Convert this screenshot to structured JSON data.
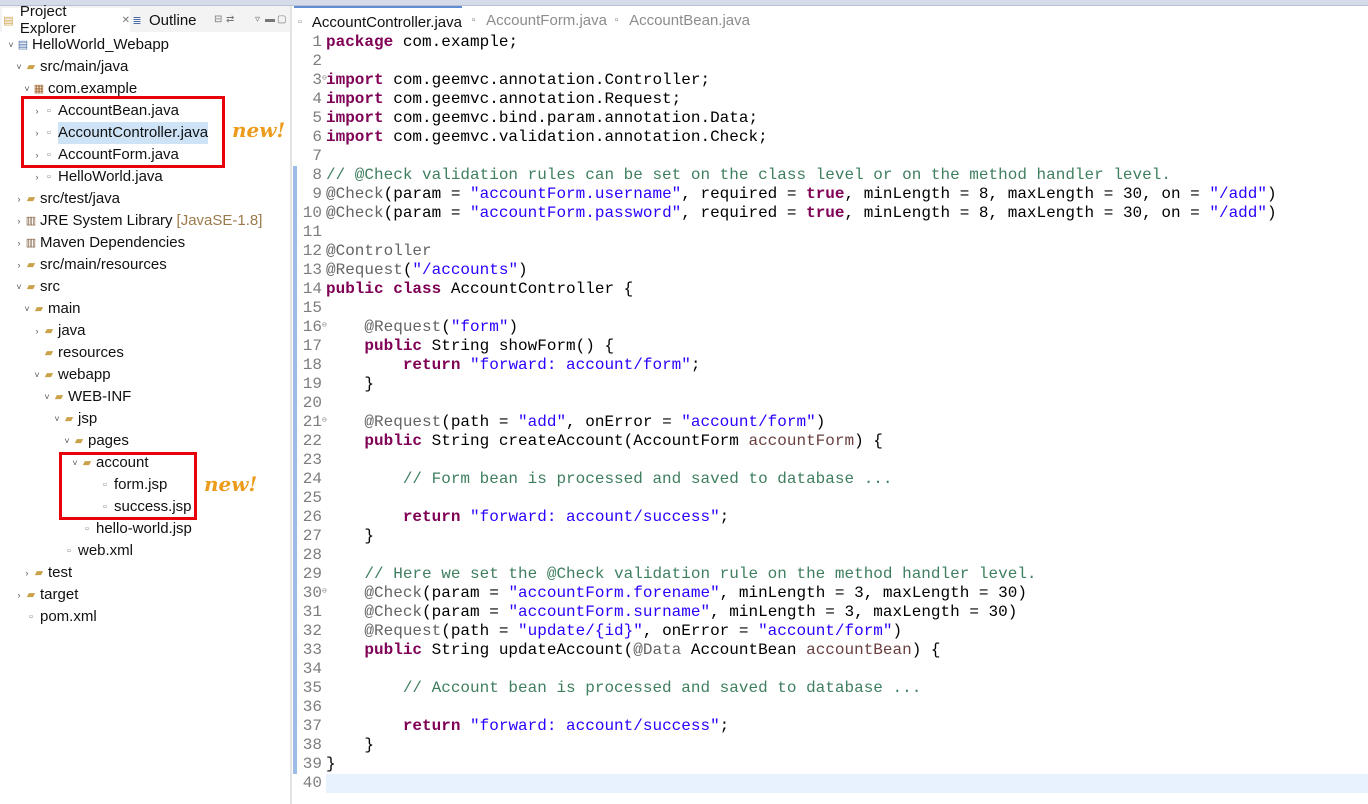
{
  "left_panel": {
    "tabs": [
      {
        "label": "Project Explorer",
        "icon": "project-explorer-icon",
        "active": true
      },
      {
        "label": "Outline",
        "icon": "outline-icon",
        "active": false
      }
    ],
    "tree": [
      {
        "label": "HelloWorld_Webapp",
        "twisty": "˅",
        "icon": "project-icon",
        "selected": false
      },
      {
        "label": "src/main/java",
        "twisty": "˅",
        "icon": "source-folder-icon"
      },
      {
        "label": "com.example",
        "twisty": "˅",
        "icon": "package-icon"
      },
      {
        "label": "AccountBean.java",
        "twisty": "›",
        "icon": "java-file-icon"
      },
      {
        "label": "AccountController.java",
        "twisty": "›",
        "icon": "java-file-icon",
        "selected": true
      },
      {
        "label": "AccountForm.java",
        "twisty": "›",
        "icon": "java-file-icon"
      },
      {
        "label": "HelloWorld.java",
        "twisty": "›",
        "icon": "java-file-icon"
      },
      {
        "label": "src/test/java",
        "twisty": "›",
        "icon": "source-folder-icon"
      },
      {
        "label": "JRE System Library",
        "decoration": "[JavaSE-1.8]",
        "twisty": "›",
        "icon": "library-icon"
      },
      {
        "label": "Maven Dependencies",
        "twisty": "›",
        "icon": "library-icon"
      },
      {
        "label": "src/main/resources",
        "twisty": "›",
        "icon": "source-folder-icon"
      },
      {
        "label": "src",
        "twisty": "˅",
        "icon": "folder-icon"
      },
      {
        "label": "main",
        "twisty": "˅",
        "icon": "folder-icon"
      },
      {
        "label": "java",
        "twisty": "›",
        "icon": "folder-icon"
      },
      {
        "label": "resources",
        "twisty": "",
        "icon": "folder-icon"
      },
      {
        "label": "webapp",
        "twisty": "˅",
        "icon": "folder-icon"
      },
      {
        "label": "WEB-INF",
        "twisty": "˅",
        "icon": "folder-icon"
      },
      {
        "label": "jsp",
        "twisty": "˅",
        "icon": "folder-icon"
      },
      {
        "label": "pages",
        "twisty": "˅",
        "icon": "folder-icon"
      },
      {
        "label": "account",
        "twisty": "˅",
        "icon": "folder-icon"
      },
      {
        "label": "form.jsp",
        "twisty": "",
        "icon": "jsp-file-icon"
      },
      {
        "label": "success.jsp",
        "twisty": "",
        "icon": "jsp-file-icon"
      },
      {
        "label": "hello-world.jsp",
        "twisty": "",
        "icon": "jsp-file-icon"
      },
      {
        "label": "web.xml",
        "twisty": "",
        "icon": "xml-file-icon"
      },
      {
        "label": "test",
        "twisty": "›",
        "icon": "folder-icon"
      },
      {
        "label": "target",
        "twisty": "›",
        "icon": "folder-icon"
      },
      {
        "label": "pom.xml",
        "twisty": "",
        "icon": "xml-file-icon"
      }
    ],
    "annotations": [
      "new!",
      "new!"
    ]
  },
  "editor": {
    "tabs": [
      {
        "label": "AccountController.java",
        "icon": "java-file-icon",
        "active": true
      },
      {
        "label": "AccountForm.java",
        "icon": "java-file-icon",
        "active": false
      },
      {
        "label": "AccountBean.java",
        "icon": "java-file-icon",
        "active": false
      }
    ],
    "lines": [
      [
        [
          "kw",
          "package"
        ],
        [
          "",
          "&nbsp;com.example;"
        ]
      ],
      [],
      [
        [
          "kw",
          "import"
        ],
        [
          "",
          "&nbsp;com.geemvc.annotation.Controller;"
        ]
      ],
      [
        [
          "kw",
          "import"
        ],
        [
          "",
          "&nbsp;com.geemvc.annotation.Request;"
        ]
      ],
      [
        [
          "kw",
          "import"
        ],
        [
          "",
          "&nbsp;com.geemvc.bind.param.annotation.Data;"
        ]
      ],
      [
        [
          "kw",
          "import"
        ],
        [
          "",
          "&nbsp;com.geemvc.validation.annotation.Check;"
        ]
      ],
      [],
      [
        [
          "cm",
          "// @Check validation rules can be set on the class level or on the method handler level."
        ]
      ],
      [
        [
          "an",
          "@Check"
        ],
        [
          "",
          "(param = "
        ],
        [
          "st",
          "\"accountForm.username\""
        ],
        [
          "",
          ", required = "
        ],
        [
          "kw",
          "true"
        ],
        [
          "",
          ", minLength = 8, maxLength = 30, on = "
        ],
        [
          "st",
          "\"/add\""
        ],
        [
          "",
          ")"
        ]
      ],
      [
        [
          "an",
          "@Check"
        ],
        [
          "",
          "(param = "
        ],
        [
          "st",
          "\"accountForm.password\""
        ],
        [
          "",
          ", required = "
        ],
        [
          "kw",
          "true"
        ],
        [
          "",
          ", minLength = 8, maxLength = 30, on = "
        ],
        [
          "st",
          "\"/add\""
        ],
        [
          "",
          ")"
        ]
      ],
      [],
      [
        [
          "an",
          "@Controller"
        ]
      ],
      [
        [
          "an",
          "@Request"
        ],
        [
          "",
          "("
        ],
        [
          "st",
          "\"/accounts\""
        ],
        [
          "",
          ")"
        ]
      ],
      [
        [
          "kw",
          "public"
        ],
        [
          "",
          "&nbsp;"
        ],
        [
          "kw",
          "class"
        ],
        [
          "",
          "&nbsp;AccountController {"
        ]
      ],
      [],
      [
        [
          "",
          "    "
        ],
        [
          "an",
          "@Request"
        ],
        [
          "",
          "("
        ],
        [
          "st",
          "\"form\""
        ],
        [
          "",
          ")"
        ]
      ],
      [
        [
          "",
          "    "
        ],
        [
          "kw",
          "public"
        ],
        [
          "",
          "&nbsp;String showForm() {"
        ]
      ],
      [
        [
          "",
          "        "
        ],
        [
          "kw",
          "return"
        ],
        [
          "",
          "&nbsp;"
        ],
        [
          "st",
          "\"forward: account/form\""
        ],
        [
          "",
          ";"
        ]
      ],
      [
        [
          "",
          "    }"
        ]
      ],
      [],
      [
        [
          "",
          "    "
        ],
        [
          "an",
          "@Request"
        ],
        [
          "",
          "(path = "
        ],
        [
          "st",
          "\"add\""
        ],
        [
          "",
          ", onError = "
        ],
        [
          "st",
          "\"account/form\""
        ],
        [
          "",
          ")"
        ]
      ],
      [
        [
          "",
          "    "
        ],
        [
          "kw",
          "public"
        ],
        [
          "",
          "&nbsp;String createAccount(AccountForm "
        ],
        [
          "pa",
          "accountForm"
        ],
        [
          "",
          ") {"
        ]
      ],
      [],
      [
        [
          "",
          "        "
        ],
        [
          "cm",
          "// Form bean is processed and saved to database ..."
        ]
      ],
      [],
      [
        [
          "",
          "        "
        ],
        [
          "kw",
          "return"
        ],
        [
          "",
          "&nbsp;"
        ],
        [
          "st",
          "\"forward: account/success\""
        ],
        [
          "",
          ";"
        ]
      ],
      [
        [
          "",
          "    }"
        ]
      ],
      [],
      [
        [
          "",
          "    "
        ],
        [
          "cm",
          "// Here we set the @Check validation rule on the method handler level."
        ]
      ],
      [
        [
          "",
          "    "
        ],
        [
          "an",
          "@Check"
        ],
        [
          "",
          "(param = "
        ],
        [
          "st",
          "\"accountForm.forename\""
        ],
        [
          "",
          ", minLength = 3, maxLength = 30)"
        ]
      ],
      [
        [
          "",
          "    "
        ],
        [
          "an",
          "@Check"
        ],
        [
          "",
          "(param = "
        ],
        [
          "st",
          "\"accountForm.surname\""
        ],
        [
          "",
          ", minLength = 3, maxLength = 30)"
        ]
      ],
      [
        [
          "",
          "    "
        ],
        [
          "an",
          "@Request"
        ],
        [
          "",
          "(path = "
        ],
        [
          "st",
          "\"update/{id}\""
        ],
        [
          "",
          ", onError = "
        ],
        [
          "st",
          "\"account/form\""
        ],
        [
          "",
          ")"
        ]
      ],
      [
        [
          "",
          "    "
        ],
        [
          "kw",
          "public"
        ],
        [
          "",
          "&nbsp;String updateAccount("
        ],
        [
          "an",
          "@Data"
        ],
        [
          "",
          "&nbsp;AccountBean "
        ],
        [
          "pa",
          "accountBean"
        ],
        [
          "",
          ") {"
        ]
      ],
      [],
      [
        [
          "",
          "        "
        ],
        [
          "cm",
          "// Account bean is processed and saved to database ..."
        ]
      ],
      [],
      [
        [
          "",
          "        "
        ],
        [
          "kw",
          "return"
        ],
        [
          "",
          "&nbsp;"
        ],
        [
          "st",
          "\"forward: account/success\""
        ],
        [
          "",
          ";"
        ]
      ],
      [
        [
          "",
          "    }"
        ]
      ],
      [
        [
          "",
          "}"
        ]
      ],
      []
    ]
  },
  "colors": {
    "keyword": "#7f0055",
    "string": "#2a00ff",
    "comment": "#3f7f5f",
    "annotation": "#646464",
    "param": "#6a3e3e",
    "highlight_box": "#e8000b",
    "new_label": "#ec9b1c"
  }
}
